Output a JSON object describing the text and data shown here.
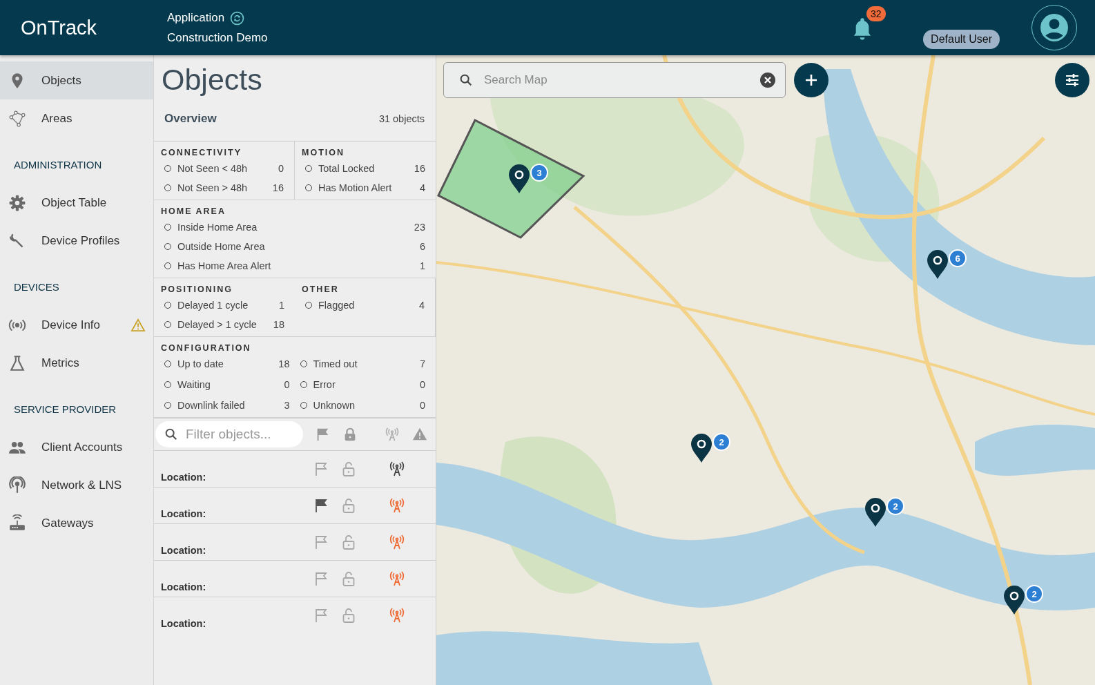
{
  "header": {
    "logo": "OnTrack",
    "app_label": "Application",
    "app_name": "Construction Demo",
    "notification_count": "32",
    "user_role": "Default User"
  },
  "sidebar": {
    "items": [
      {
        "kind": "item",
        "label": "Objects",
        "selected": true,
        "warning": false
      },
      {
        "kind": "item",
        "label": "Areas",
        "selected": false,
        "warning": false
      },
      {
        "kind": "heading",
        "label": "ADMINISTRATION"
      },
      {
        "kind": "item",
        "label": "Object Table",
        "selected": false,
        "warning": false
      },
      {
        "kind": "item",
        "label": "Device Profiles",
        "selected": false,
        "warning": false
      },
      {
        "kind": "heading",
        "label": "DEVICES"
      },
      {
        "kind": "item",
        "label": "Device Info",
        "selected": false,
        "warning": true
      },
      {
        "kind": "item",
        "label": "Metrics",
        "selected": false,
        "warning": false
      },
      {
        "kind": "heading",
        "label": "SERVICE PROVIDER"
      },
      {
        "kind": "item",
        "label": "Client Accounts",
        "selected": false,
        "warning": false
      },
      {
        "kind": "item",
        "label": "Network & LNS",
        "selected": false,
        "warning": false
      },
      {
        "kind": "item",
        "label": "Gateways",
        "selected": false,
        "warning": false
      }
    ]
  },
  "panel": {
    "title": "Objects",
    "overview": {
      "title": "Overview",
      "count": "31 objects"
    },
    "sections": [
      {
        "kind": "half",
        "title": "CONNECTIVITY",
        "items": [
          {
            "label": "Not Seen < 48h",
            "value": "0"
          },
          {
            "label": "Not Seen > 48h",
            "value": "16"
          }
        ]
      },
      {
        "kind": "half",
        "title": "MOTION",
        "items": [
          {
            "label": "Total Locked",
            "value": "16"
          },
          {
            "label": "Has Motion Alert",
            "value": "4"
          }
        ]
      },
      {
        "kind": "full",
        "title": "HOME AREA",
        "items": [
          {
            "label": "Inside Home Area",
            "value": "23"
          },
          {
            "label": "Outside Home Area",
            "value": "6"
          },
          {
            "label": "Has Home Area Alert",
            "value": "1"
          }
        ]
      },
      {
        "kind": "half",
        "title": "POSITIONING",
        "items": [
          {
            "label": "Delayed 1 cycle",
            "value": "1"
          },
          {
            "label": "Delayed > 1 cycle",
            "value": "18"
          }
        ]
      },
      {
        "kind": "half",
        "title": "OTHER",
        "items": [
          {
            "label": "Flagged",
            "value": "4"
          }
        ]
      },
      {
        "kind": "grid",
        "title": "CONFIGURATION",
        "items": [
          {
            "label": "Up to date",
            "value": "18"
          },
          {
            "label": "Timed out",
            "value": "7"
          },
          {
            "label": "Waiting",
            "value": "0"
          },
          {
            "label": "Error",
            "value": "0"
          },
          {
            "label": "Downlink failed",
            "value": "3"
          },
          {
            "label": "Unknown",
            "value": "0"
          }
        ]
      }
    ],
    "filter": {
      "placeholder": "Filter objects..."
    },
    "rows": [
      {
        "location_label": "Location:",
        "flagged": false,
        "signal_alert": false
      },
      {
        "location_label": "Location:",
        "flagged": true,
        "signal_alert": true
      },
      {
        "location_label": "Location:",
        "flagged": false,
        "signal_alert": true
      },
      {
        "location_label": "Location:",
        "flagged": false,
        "signal_alert": true
      },
      {
        "location_label": "Location:",
        "flagged": false,
        "signal_alert": true
      }
    ]
  },
  "map": {
    "search": {
      "placeholder": "Search Map"
    },
    "clusters": [
      {
        "count": "3"
      },
      {
        "count": "6"
      },
      {
        "count": "2"
      },
      {
        "count": "2"
      },
      {
        "count": "2"
      }
    ]
  }
}
